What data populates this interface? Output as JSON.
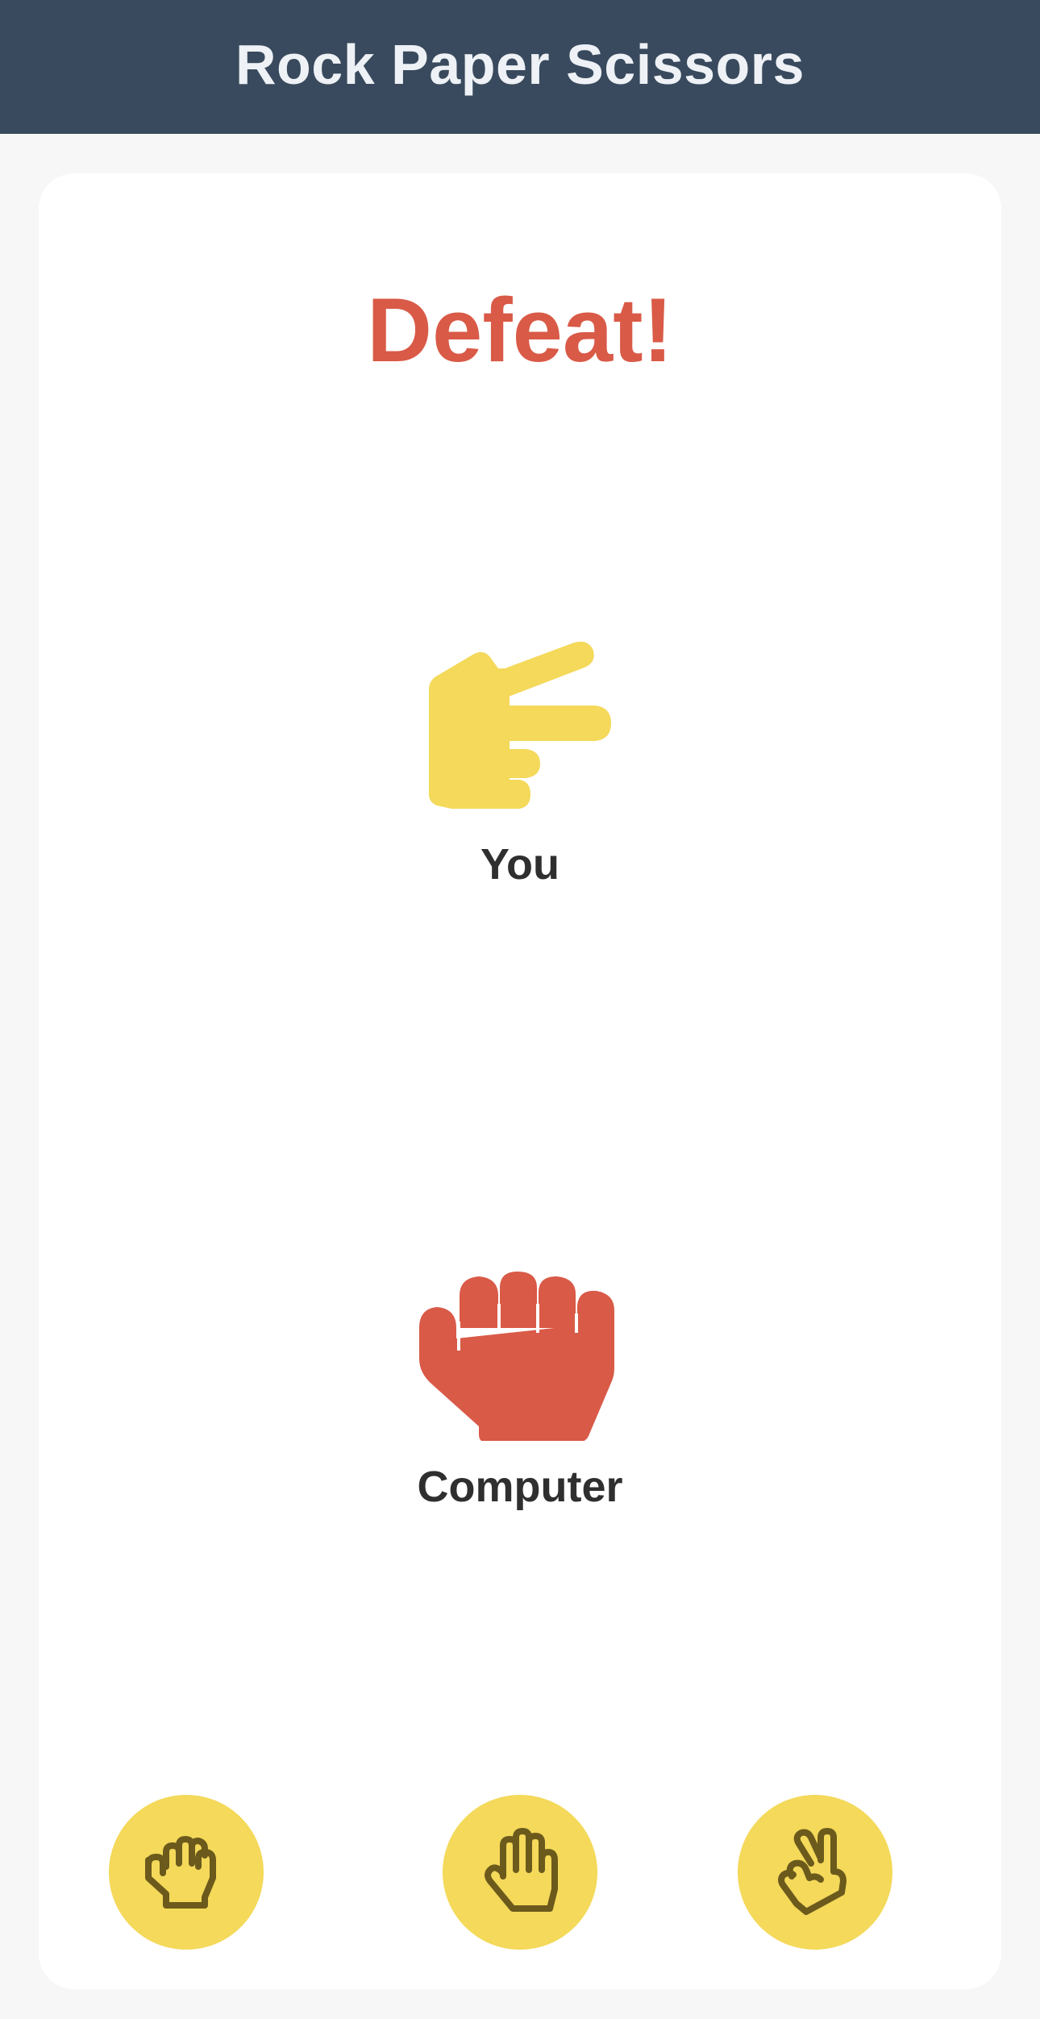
{
  "header": {
    "title": "Rock Paper Scissors"
  },
  "result": {
    "text": "Defeat!",
    "color": "#d95a47"
  },
  "player": {
    "label": "You",
    "choice_icon": "scissors-hand-icon",
    "color": "#f4d95a"
  },
  "computer": {
    "label": "Computer",
    "choice_icon": "rock-hand-icon",
    "color": "#d95a47"
  },
  "choices": [
    {
      "name": "rock",
      "icon": "fist-icon"
    },
    {
      "name": "paper",
      "icon": "open-hand-icon"
    },
    {
      "name": "scissors",
      "icon": "victory-hand-icon"
    }
  ],
  "colors": {
    "header_bg": "#394a5e",
    "button_bg": "#f4d95a",
    "button_icon": "#6b5a1c"
  }
}
